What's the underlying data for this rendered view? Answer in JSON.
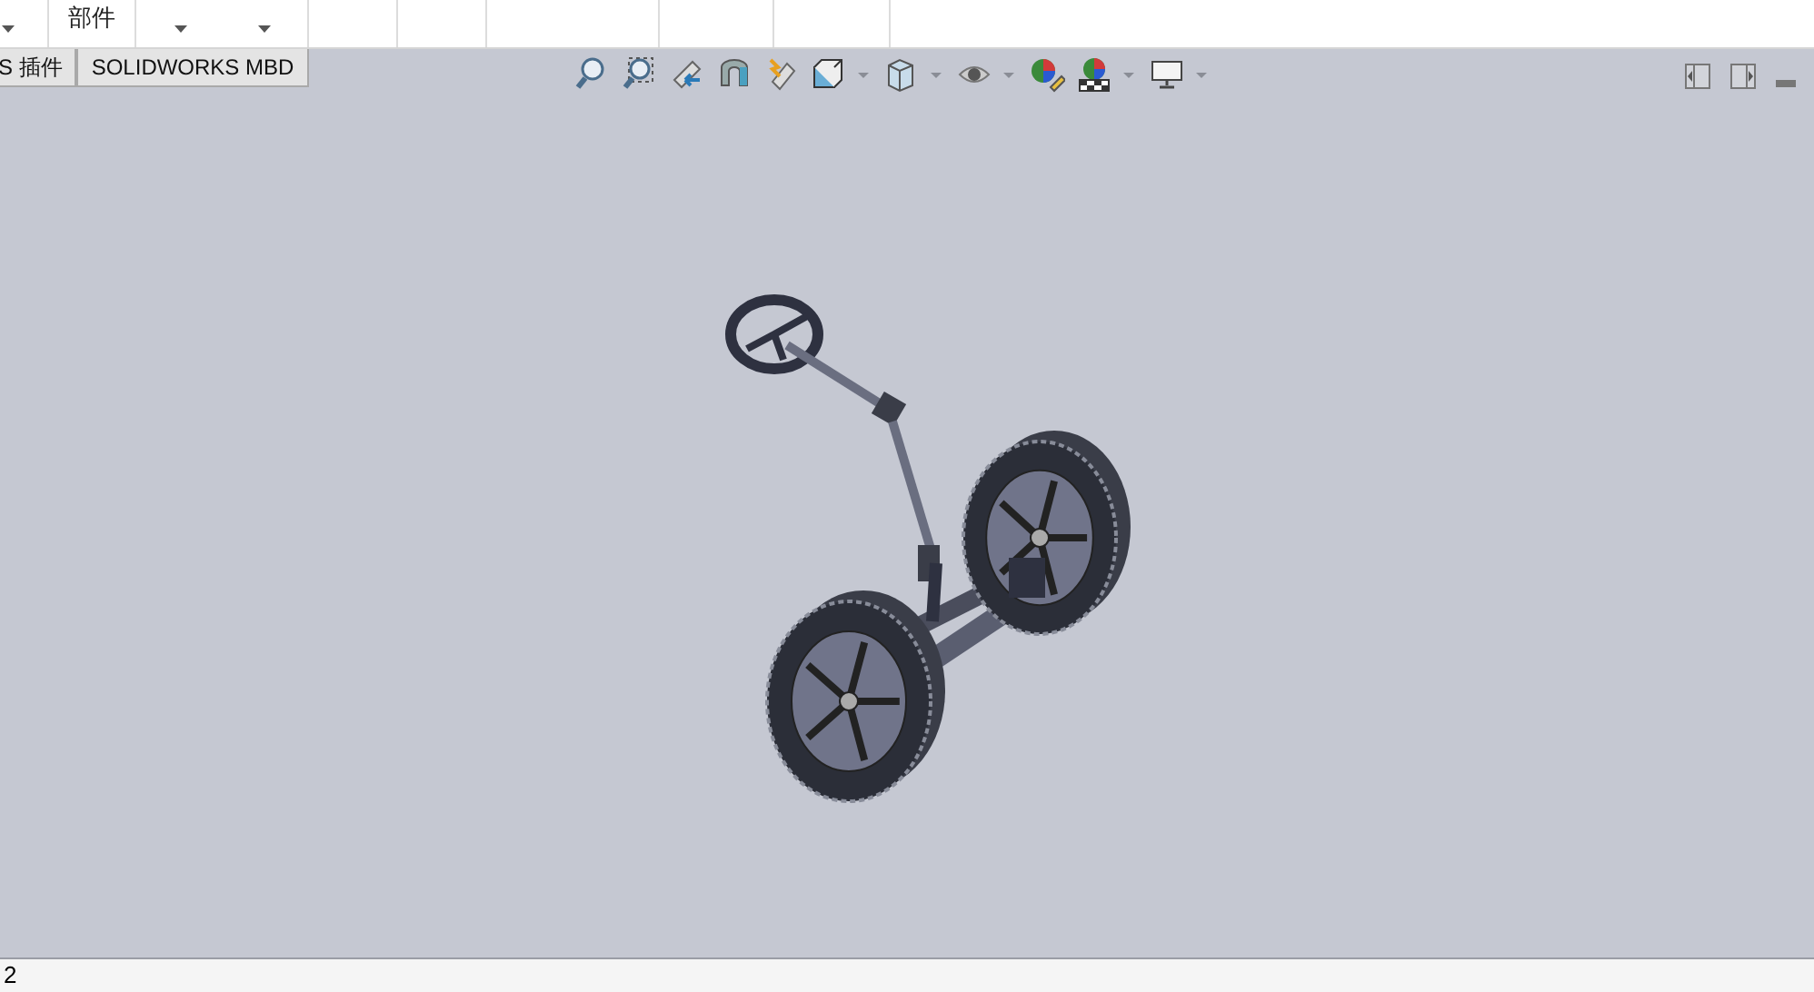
{
  "ribbon": {
    "groups": [
      {
        "kind": "caret"
      },
      {
        "kind": "label",
        "label": "部件"
      },
      {
        "kind": "carets"
      },
      {
        "kind": "blank"
      },
      {
        "kind": "blank"
      },
      {
        "kind": "blank"
      },
      {
        "kind": "blank"
      },
      {
        "kind": "blank"
      }
    ]
  },
  "tabs": [
    {
      "label": "S 插件",
      "selected": false
    },
    {
      "label": "SOLIDWORKS MBD",
      "selected": false
    }
  ],
  "status_bar": {
    "cells": [
      "2"
    ]
  }
}
